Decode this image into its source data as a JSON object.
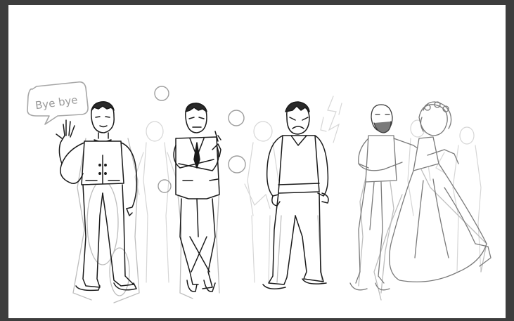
{
  "speech_bubble": {
    "text": "Bye bye"
  },
  "colors": {
    "frame": "#3d3d3d",
    "canvas": "#ffffff",
    "ink": "#1a1a1a",
    "sketch": "#b8b8b8",
    "faint": "#d4d4d4"
  }
}
